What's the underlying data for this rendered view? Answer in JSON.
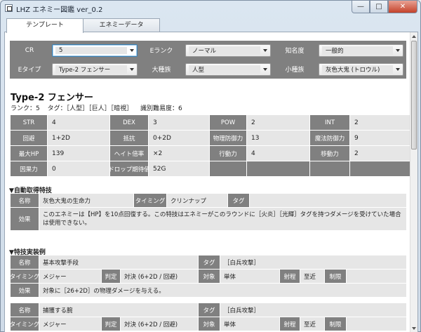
{
  "window": {
    "title": "LHZ エネミー図鑑 ver_0.2",
    "minimize_glyph": "—",
    "maximize_glyph": "□",
    "close_glyph": "✕"
  },
  "tabs": [
    {
      "label": "テンプレート"
    },
    {
      "label": "エネミーデータ"
    }
  ],
  "controls": [
    {
      "label": "CR",
      "value": "5"
    },
    {
      "label": "Eランク",
      "value": "ノーマル"
    },
    {
      "label": "知名度",
      "value": "一般的"
    },
    {
      "label": "Eタイプ",
      "value": "Type-2 フェンサー"
    },
    {
      "label": "大種族",
      "value": "人型"
    },
    {
      "label": "小種族",
      "value": "灰色大鬼 (トロウル)"
    }
  ],
  "enemy": {
    "name": "Type-2 フェンサー",
    "rank": "ランク：5",
    "tags": "タグ：［人型］［巨人］［暗視］",
    "difficulty": "識別難易度：6"
  },
  "stats": [
    [
      {
        "l": "STR",
        "v": "4"
      },
      {
        "l": "DEX",
        "v": "3"
      },
      {
        "l": "POW",
        "v": "2"
      },
      {
        "l": "INT",
        "v": "2"
      }
    ],
    [
      {
        "l": "回避",
        "v": "1+2D"
      },
      {
        "l": "抵抗",
        "v": "0+2D"
      },
      {
        "l": "物理防御力",
        "v": "13"
      },
      {
        "l": "魔法防御力",
        "v": "9"
      }
    ],
    [
      {
        "l": "最大HP",
        "v": "139"
      },
      {
        "l": "ヘイト倍率",
        "v": "×2"
      },
      {
        "l": "行動力",
        "v": "4"
      },
      {
        "l": "移動力",
        "v": "2"
      }
    ],
    [
      {
        "l": "因果力",
        "v": "0"
      },
      {
        "l": "ドロップ期待値",
        "v": "52G"
      }
    ]
  ],
  "auto_skills": {
    "section_title": "▼自動取得特技",
    "name_label": "名称",
    "name": "灰色大鬼の生命力",
    "timing_label": "タイミング",
    "timing": "クリンナップ",
    "tag_label": "タグ",
    "tag": "",
    "effect_label": "効果",
    "effect": "このエネミーは【HP】を10点回復する。この特技はエネミーがこのラウンドに［火炎］［光輝］タグを持つダメージを受けていた場合は使用できない。"
  },
  "skill_examples": {
    "section_title": "▼特技実装例",
    "items": [
      {
        "name_label": "名称",
        "name": "基本攻撃手段",
        "tag_label": "タグ",
        "tag": "［白兵攻撃］",
        "timing_label": "タイミング",
        "timing": "メジャー",
        "check_label": "判定",
        "check": "対決 (6+2D / 回避)",
        "target_label": "対象",
        "target": "単体",
        "range_label": "射程",
        "range": "至近",
        "limit_label": "制限",
        "limit": "",
        "effect_label": "効果",
        "effect": "対象に［26+2D］の物理ダメージを与える。"
      },
      {
        "name_label": "名称",
        "name": "捕獲する腕",
        "tag_label": "タグ",
        "tag": "［白兵攻撃］",
        "timing_label": "タイミング",
        "timing": "メジャー",
        "check_label": "判定",
        "check": "対決 (6+2D / 回避)",
        "target_label": "対象",
        "target": "単体",
        "range_label": "射程",
        "range": "至近",
        "limit_label": "制限",
        "limit": ""
      }
    ]
  }
}
